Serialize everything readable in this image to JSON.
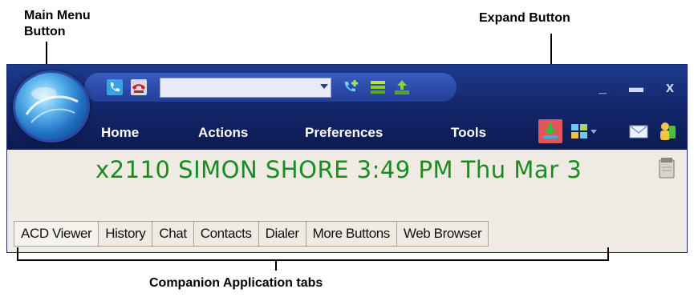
{
  "callouts": {
    "main_menu_line1": "Main Menu",
    "main_menu_line2": "Button",
    "expand": "Expand Button",
    "tabs": "Companion Application tabs"
  },
  "toolbar": {
    "number_combo_value": "",
    "buttons": [
      "phone-icon",
      "hangup-icon",
      "transfer-call-icon",
      "hold-icon",
      "pickup-icon"
    ]
  },
  "menu": {
    "items": [
      "Home",
      "Actions",
      "Preferences",
      "Tools"
    ]
  },
  "window_controls": {
    "minimize": "_",
    "maximize": "▬",
    "close": "x"
  },
  "status": {
    "text": "x2110 SIMON SHORE  3:49 PM Thu Mar 3"
  },
  "tabs": [
    "ACD Viewer",
    "History",
    "Chat",
    "Contacts",
    "Dialer",
    "More Buttons",
    "Web Browser"
  ],
  "colors": {
    "titlebar": "#14286e",
    "status_text": "#1a8c22",
    "expand_button": "#e1565c"
  }
}
